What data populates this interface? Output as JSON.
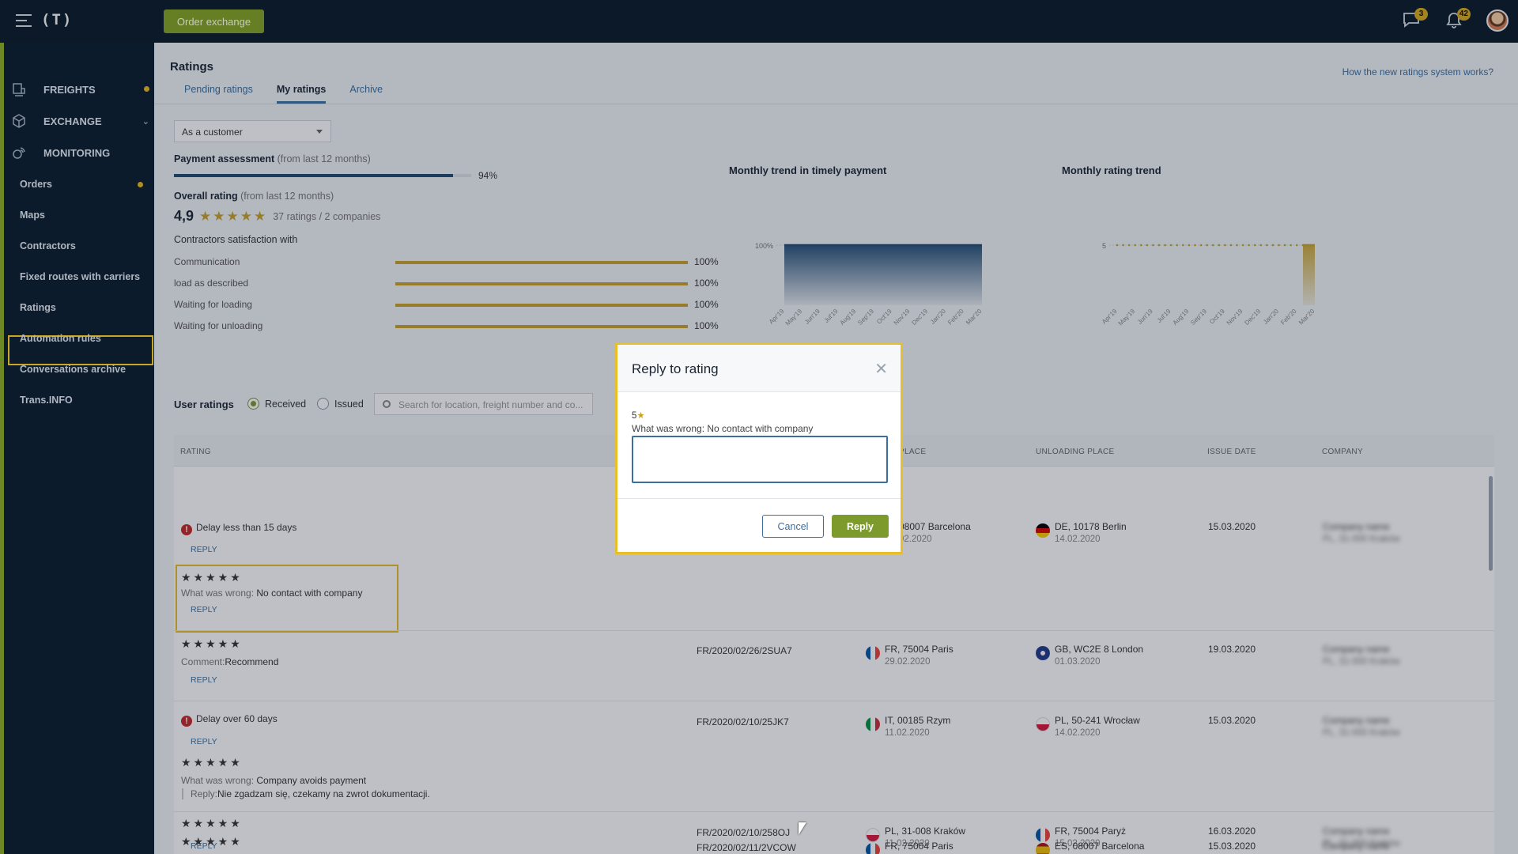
{
  "topbar": {
    "logo": "(T)",
    "order_exchange": "Order exchange",
    "messages_badge": "3",
    "notifications_badge": "42"
  },
  "sidebar": {
    "main": [
      {
        "label": "FREIGHTS",
        "icon": "freights-icon"
      },
      {
        "label": "EXCHANGE",
        "icon": "exchange-icon"
      },
      {
        "label": "MONITORING",
        "icon": "monitoring-icon"
      }
    ],
    "items": [
      {
        "label": "Orders"
      },
      {
        "label": "Maps"
      },
      {
        "label": "Contractors"
      },
      {
        "label": "Fixed routes with carriers"
      },
      {
        "label": "Ratings"
      },
      {
        "label": "Automation rules"
      },
      {
        "label": "Conversations archive"
      },
      {
        "label": "Trans.INFO"
      }
    ]
  },
  "page": {
    "title": "Ratings",
    "howto_link": "How the new ratings system works?",
    "tabs": [
      {
        "label": "Pending ratings"
      },
      {
        "label": "My ratings"
      },
      {
        "label": "Archive"
      }
    ],
    "role_select": "As a customer"
  },
  "summary": {
    "payment_label": "Payment assessment",
    "period": "(from last 12 months)",
    "payment_value": 0.94,
    "payment_pct": "94%",
    "overall_label": "Overall rating",
    "overall_score": "4,9",
    "overall_stars": "★★★★★",
    "overall_counts": "37 ratings / 2 companies",
    "satisfaction_title": "Contractors satisfaction with",
    "satisfaction": [
      {
        "name": "Communication",
        "pct": "100%"
      },
      {
        "name": "load as described",
        "pct": "100%"
      },
      {
        "name": "Waiting for loading",
        "pct": "100%"
      },
      {
        "name": "Waiting for unloading",
        "pct": "100%"
      }
    ]
  },
  "chart_data": [
    {
      "type": "area",
      "title": "Monthly trend in timely payment",
      "y_tick": "100%",
      "categories": [
        "Apr'19",
        "May'19",
        "Jun'19",
        "Jul'19",
        "Aug'19",
        "Sep'19",
        "Oct'19",
        "Nov'19",
        "Dec'19",
        "Jan'20",
        "Feb'20",
        "Mar'20"
      ],
      "values": [
        100,
        100,
        100,
        100,
        100,
        100,
        100,
        100,
        100,
        100,
        100,
        100
      ],
      "ylim": [
        0,
        100
      ],
      "color": "#1e4a73"
    },
    {
      "type": "bar",
      "title": "Monthly rating trend",
      "y_tick": "5",
      "categories": [
        "Apr'19",
        "May'19",
        "Jun'19",
        "Jul'19",
        "Aug'19",
        "Sep'19",
        "Oct'19",
        "Nov'19",
        "Dec'19",
        "Jan'20",
        "Feb'20",
        "Mar'20"
      ],
      "values": [
        null,
        null,
        null,
        null,
        null,
        null,
        null,
        null,
        null,
        null,
        null,
        5
      ],
      "ylim": [
        0,
        5
      ],
      "color": "#c9a227"
    }
  ],
  "ratings": {
    "title": "User ratings",
    "filter_received": "Received",
    "filter_issued": "Issued",
    "search_placeholder": "Search for location, freight number and co...",
    "headers": {
      "rating": "RATING",
      "loading_place": "PLACE",
      "unloading_place": "UNLOADING PLACE",
      "issue_date": "ISSUE DATE",
      "company": "COMPANY"
    },
    "reply_label": "REPLY",
    "stars": "★★★★★",
    "wrong_prefix": "What was wrong:",
    "comment_prefix": "Comment:",
    "reply_prefix": "Reply:",
    "rows": [
      {
        "delay": "Delay less than 15 days",
        "wrong": "No contact with company",
        "freight": "",
        "loading": "08007 Barcelona",
        "loading_date": "02.2020",
        "unloading": "DE, 10178 Berlin",
        "unloading_date": "14.02.2020",
        "issue_date": "15.03.2020",
        "company": "Company name",
        "company_sub": "PL, 31-000 Kraków"
      },
      {
        "comment": "Recommend",
        "freight": "FR/2020/02/26/2SUA7",
        "loading": "FR, 75004 Paris",
        "loading_date": "29.02.2020",
        "unloading": "GB, WC2E 8 London",
        "unloading_date": "01.03.2020",
        "issue_date": "19.03.2020",
        "company": "Company name",
        "company_sub": "PL, 31-000 Kraków"
      },
      {
        "delay": "Delay over 60 days",
        "wrong": "Company avoids payment",
        "reply": "Nie zgadzam się, czekamy na zwrot dokumentacji.",
        "freight": "FR/2020/02/10/25JK7",
        "loading": "IT, 00185 Rzym",
        "loading_date": "11.02.2020",
        "unloading": "PL, 50-241 Wrocław",
        "unloading_date": "14.02.2020",
        "issue_date": "15.03.2020",
        "company": "Company name",
        "company_sub": "PL, 31-000 Kraków"
      },
      {
        "freight": "FR/2020/02/10/258OJ",
        "loading": "PL, 31-008 Kraków",
        "loading_date": "11.02.2020",
        "unloading": "FR, 75004 Paryż",
        "unloading_date": "15.02.2020",
        "issue_date": "16.03.2020",
        "company": "Company name",
        "company_sub": "PL, 31-000 Kraków"
      },
      {
        "freight": "FR/2020/02/11/2VCOW",
        "loading": "FR, 75004 Paris",
        "unloading": "ES, 08007 Barcelona",
        "issue_date": "15.03.2020",
        "company": "Company name"
      }
    ]
  },
  "modal": {
    "title": "Reply to rating",
    "score": "5",
    "star": "★",
    "wrong_line": "What was wrong: No contact with company",
    "cancel": "Cancel",
    "reply": "Reply"
  }
}
